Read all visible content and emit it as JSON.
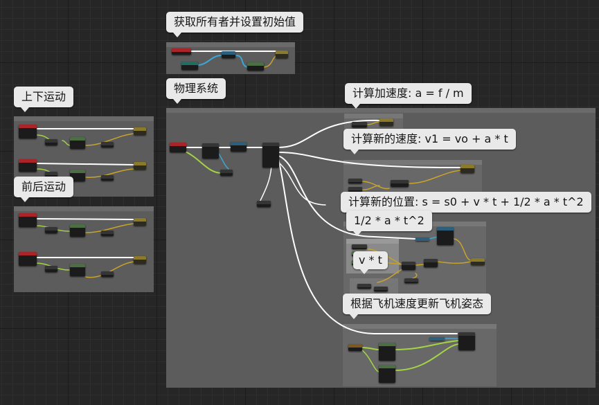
{
  "groups": {
    "init": {
      "title": "获取所有者并设置初始值"
    },
    "physics": {
      "title": "物理系统"
    },
    "updown": {
      "title": "上下运动"
    },
    "frontback": {
      "title": "前后运动"
    },
    "accel": {
      "title": "计算加速度: a = f / m"
    },
    "velocity": {
      "title": "计算新的速度: v1 = vo + a * t"
    },
    "position": {
      "title": "计算新的位置: s = s0 + v * t + 1/2 * a * t^2"
    },
    "half_term": {
      "title": "1/2 * a * t^2"
    },
    "vt": {
      "title": "v * t"
    },
    "attitude": {
      "title": "根据飞机速度更新飞机姿态"
    }
  },
  "colors": {
    "grid_bg": "#262626",
    "comment_bg": "#5c5c5c",
    "exec_wire": "#ffffff",
    "float_wire": "#c9a42a",
    "vector_wire": "#a4d444",
    "object_wire": "#3ba7d6",
    "event_header": "#a8262a",
    "pure_header": "#4b6e45",
    "call_header": "#2c5f7c"
  }
}
